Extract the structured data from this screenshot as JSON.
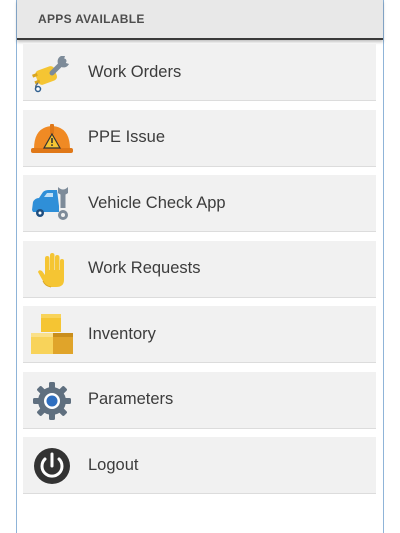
{
  "header": {
    "title": "APPS AVAILABLE"
  },
  "apps": [
    {
      "label": "Work Orders",
      "icon": "wrench-plug-icon"
    },
    {
      "label": "PPE Issue",
      "icon": "hard-hat-warning-icon"
    },
    {
      "label": "Vehicle Check App",
      "icon": "car-wrench-icon"
    },
    {
      "label": "Work Requests",
      "icon": "hand-icon"
    },
    {
      "label": "Inventory",
      "icon": "boxes-icon"
    },
    {
      "label": "Parameters",
      "icon": "gear-icon"
    },
    {
      "label": "Logout",
      "icon": "power-icon"
    }
  ],
  "colors": {
    "header_bg": "#e8e8e8",
    "item_bg": "#f1f1f1",
    "frame_border": "#8fb4d8",
    "icon_yellow": "#f5c533",
    "icon_orange": "#f08a24",
    "icon_blue": "#2f8fd8",
    "icon_gray": "#5f6f7f"
  }
}
